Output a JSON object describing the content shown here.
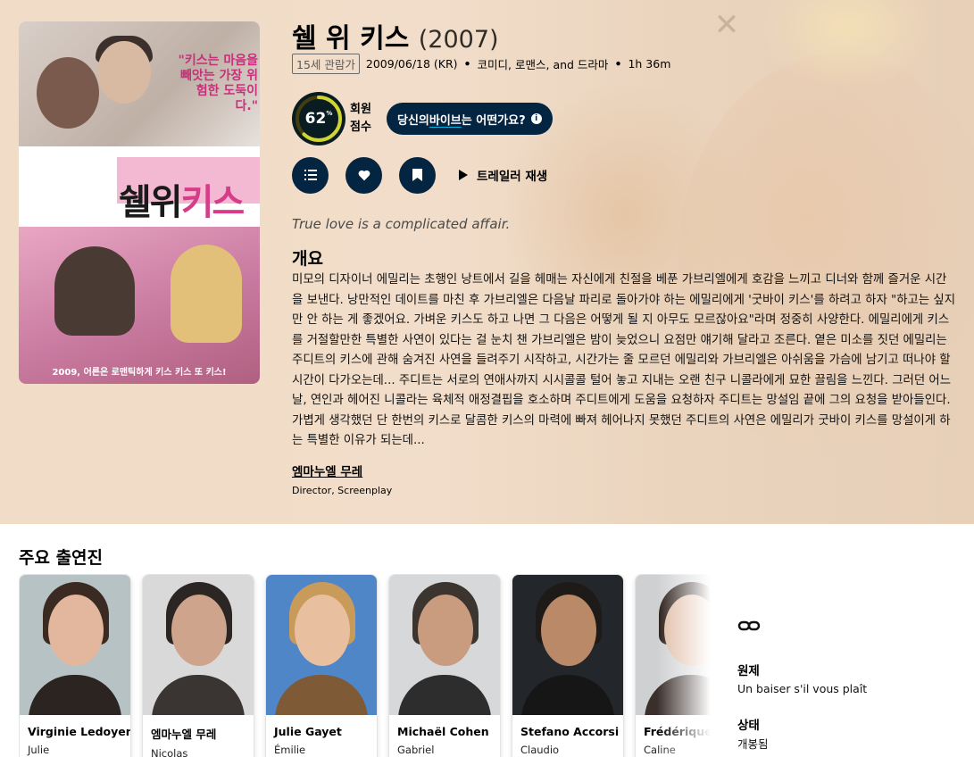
{
  "movie": {
    "title": "쉘 위 키스",
    "year": "(2007)",
    "certification": "15세 관람가",
    "release": "2009/06/18 (KR)",
    "genres": "코미디, 로맨스, and 드라마",
    "runtime": "1h 36m",
    "score": "62",
    "score_sup": "%",
    "score_fraction": 0.62,
    "score_label": "회원 점수",
    "vibe_prefix": "당신의 ",
    "vibe_highlight": "바이브",
    "vibe_suffix": "는 어떤가요?",
    "trailer": "트레일러 재생",
    "tagline": "True love is a complicated affair.",
    "overview_heading": "개요",
    "overview": "미모의 디자이너 에밀리는 초행인 낭트에서 길을 헤매는 자신에게 친절을 베푼 가브리엘에게 호감을 느끼고 디너와 함께 즐거운 시간을 보낸다. 낭만적인 데이트를 마친 후 가브리엘은 다음날 파리로 돌아가야 하는 에밀리에게 '굿바이 키스'를 하려고 하자 \"하고는 싶지만 안 하는 게 좋겠어요. 가벼운 키스도 하고 나면 그 다음은 어떻게 될 지 아무도 모르잖아요\"라며 정중히 사양한다. 에밀리에게 키스를 거절할만한 특별한 사연이 있다는 걸 눈치 챈 가브리엘은 밤이 늦었으니 요점만 얘기해 달라고 조른다. 옅은 미소를 짓던 에밀리는 주디트의 키스에 관해 숨겨진 사연을 들려주기 시작하고, 시간가는 줄 모르던 에밀리와 가브리엘은 아쉬움을 가슴에 남기고 떠나야 할 시간이 다가오는데... 주디트는 서로의 연애사까지 시시콜콜 털어 놓고 지내는 오랜 친구 니콜라에게 묘한 끌림을 느낀다. 그러던 어느 날, 연인과 헤어진 니콜라는 육체적 애정결핍을 호소하며 주디트에게 도움을 요청하자 주디트는 망설임 끝에 그의 요청을 받아들인다. 가볍게 생각했던 단 한번의 키스로 달콤한 키스의 마력에 빠져 헤어나지 못했던 주디트의 사연은 에밀리가 굿바이 키스를 망설이게 하는 특별한 이유가 되는데...",
    "crew_name": "엠마누엘 무레",
    "crew_role": "Director, Screenplay"
  },
  "poster": {
    "quote": "\"키스는 마음을 빼앗는 가장 위험한 도둑이다.\"",
    "title_black": "쉘위",
    "title_pink": "키스",
    "caption": "2009, 어른은 로맨틱하게 키스 키스 또 키스!"
  },
  "cast_heading": "주요 출연진",
  "cast": [
    {
      "name": "Virginie Ledoyen",
      "role": "Julie",
      "bg": "#b7c2c4",
      "hair": "#3a2a22",
      "skin": "#e2b79d",
      "body": "#2b2421"
    },
    {
      "name": "엠마누엘 무레",
      "role": "Nicolas",
      "bg": "#d9d9d9",
      "hair": "#2b2624",
      "skin": "#cfa48c",
      "body": "#3a3533"
    },
    {
      "name": "Julie Gayet",
      "role": "Émilie",
      "bg": "#4e86c8",
      "hair": "#c89b5a",
      "skin": "#e8c0a0",
      "body": "#7f5a36"
    },
    {
      "name": "Michaël Cohen",
      "role": "Gabriel",
      "bg": "#d6d8d9",
      "hair": "#3b342f",
      "skin": "#c99c80",
      "body": "#2d2d2d"
    },
    {
      "name": "Stefano Accorsi",
      "role": "Claudio",
      "bg": "#23272b",
      "hair": "#1d1a18",
      "skin": "#b98968",
      "body": "#161616"
    },
    {
      "name": "Frédérique Bel",
      "role": "Caline",
      "bg": "#cfd0d2",
      "hair": "#2a1d18",
      "skin": "#e0bca5",
      "body": "#3a2f2b"
    }
  ],
  "sidebar": {
    "original_title_label": "원제",
    "original_title": "Un baiser s'il vous plaît",
    "status_label": "상태",
    "status": "개봉됨"
  },
  "colors": {
    "navy": "#032541",
    "score_ring": "#d2d531",
    "score_track": "#423d0f",
    "accent_underline": "#01b4e4"
  },
  "icons": [
    "list-icon",
    "heart-icon",
    "bookmark-icon",
    "play-icon",
    "info-icon",
    "link-icon"
  ]
}
